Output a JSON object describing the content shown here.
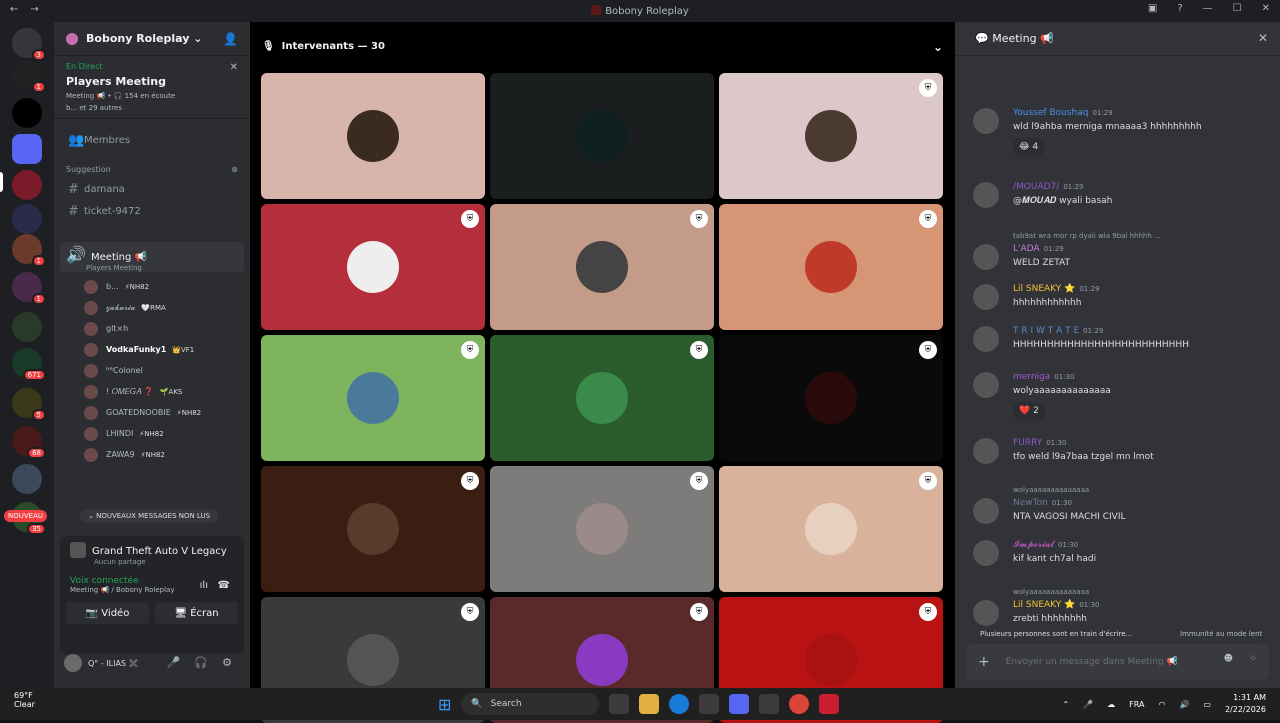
{
  "window": {
    "title": "Bobony Roleplay"
  },
  "server": {
    "name": "Bobony Roleplay"
  },
  "event": {
    "status": "En Direct",
    "name": "Players Meeting",
    "meta": "Meeting 📢 • 🎧 154 en écoute",
    "others": "b... et 29 autres"
  },
  "channels": {
    "members": "Membres",
    "category": "Suggestion",
    "list": [
      "damana",
      "ticket-9472"
    ]
  },
  "voice_channel": {
    "name": "Meeting 📢",
    "subtitle": "Players Meeting"
  },
  "voice_users": [
    {
      "name": "b...",
      "tag": "⚡NH82"
    },
    {
      "name": "𝔃𝓪𝓴𝓪𝓻𝓲𝓪",
      "tag": "🤍RMA"
    },
    {
      "name": "glt×h",
      "tag": ""
    },
    {
      "name": "VodkaFunky1",
      "tag": "👑VF1"
    },
    {
      "name": "ᴿᴿColonel",
      "tag": ""
    },
    {
      "name": "! 𝑂𝑀𝐸𝐺𝐴 ❓",
      "tag": "🌱AKS"
    },
    {
      "name": "GOATEDNOOBIE",
      "tag": "⚡NH82"
    },
    {
      "name": "LHINDI",
      "tag": "⚡NH82"
    },
    {
      "name": "ZAWA9",
      "tag": "⚡NH82"
    }
  ],
  "new_messages": "⌄ NOUVEAUX MESSAGES NON LUS",
  "nouveau": "NOUVEAU",
  "activity": {
    "game": "Grand Theft Auto V Legacy",
    "game_sub": "Aucun partage",
    "voice_status": "Voix connectée",
    "voice_detail": "Meeting 📢 / Bobony Roleplay",
    "video": "Vidéo",
    "screen": "Écran"
  },
  "user": {
    "name": "Q° - ILIAS ✖️"
  },
  "stage": {
    "header": "Intervenants — 30"
  },
  "tiles": [
    {
      "bg": "#d8b5aa",
      "av": "#3a2a20",
      "shield": false
    },
    {
      "bg": "#1a1e1e",
      "av": "#102020",
      "shield": false
    },
    {
      "bg": "#dcc8c8",
      "av": "#4a3a30",
      "shield": true
    },
    {
      "bg": "#b52e3c",
      "av": "#eee",
      "shield": true
    },
    {
      "bg": "#c49a88",
      "av": "#444",
      "shield": true
    },
    {
      "bg": "#d69575",
      "av": "#c03a2a",
      "shield": true
    },
    {
      "bg": "#7fb45f",
      "av": "#4a7a9a",
      "shield": true
    },
    {
      "bg": "#2b5c2e",
      "av": "#3a8a4a",
      "shield": true
    },
    {
      "bg": "#0a0a0a",
      "av": "#2a0a0a",
      "shield": true
    },
    {
      "bg": "#3a1e12",
      "av": "#5a3a2a",
      "shield": true
    },
    {
      "bg": "#7e7b7b",
      "av": "#9a8a8a",
      "shield": true
    },
    {
      "bg": "#d8b29a",
      "av": "#e8d0c0",
      "shield": true
    },
    {
      "bg": "#3a3a3a",
      "av": "#555",
      "shield": true
    },
    {
      "bg": "#5a2a2a",
      "av": "#8a3ac0",
      "shield": true
    },
    {
      "bg": "#b81212",
      "av": "#aa1111",
      "shield": true
    }
  ],
  "chat": {
    "title": "Meeting 📢",
    "messages": [
      {
        "name": "Youssef Boushaq",
        "color": "#4a90e2",
        "time": "01:29",
        "text": "wld l9ahba merniga mnaaaa3 hhhhhhhhh",
        "reaction": "😂 4"
      },
      {
        "name": "/MOUAD7/",
        "color": "#8a5ac8",
        "time": "01:29",
        "text": "@𝑴𝑶𝑼𝑨𝑫 wyali basah",
        "reaction": ""
      },
      {
        "name": "L'ADA",
        "color": "#c87ad8",
        "time": "01:29",
        "text": "WELD ZETAT",
        "reply": "tab9at wra mor rp dyali wla 9bal hhhhh ...",
        "reaction": ""
      },
      {
        "name": "Lil SNEAKY ⭐",
        "color": "#f0c030",
        "time": "01:29",
        "text": "hhhhhhhhhhhh",
        "reaction": ""
      },
      {
        "name": "T R I W T A T E",
        "color": "#5a8ac8",
        "time": "01:29",
        "text": "HHHHHHHHHHHHHHHHHHHHHHHHHH",
        "reaction": ""
      },
      {
        "name": "merniga",
        "color": "#a05ad0",
        "time": "01:30",
        "text": "wolyaaaaaaaaaaaaaa",
        "reaction": "❤️ 2"
      },
      {
        "name": "FURRY",
        "color": "#8a5ac8",
        "time": "01:30",
        "text": "tfo weld l9a7baa tzgel mn lmot",
        "reaction": ""
      },
      {
        "name": "NewTon",
        "color": "#6a7a9a",
        "time": "01:30",
        "text": "NTA VAGOSI MACHI CIVIL",
        "reply": "wolyaaaaaaaaaaaaaa",
        "reaction": ""
      },
      {
        "name": "𝓘𝓶𝓹𝓮𝓻𝓲𝓪𝓵",
        "color": "#c85ac8",
        "time": "01:30",
        "text": "kif kant ch7al hadi",
        "reaction": ""
      },
      {
        "name": "Lil SNEAKY ⭐",
        "color": "#f0c030",
        "time": "01:30",
        "text": "zrebti hhhhhhhh",
        "reply": "wolyaaaaaaaaaaaaaa",
        "reaction": ""
      }
    ],
    "typing": "Plusieurs personnes sont en train d'écrire...",
    "immunity": "Immunité au mode lent",
    "placeholder": "Envoyer un message dans Meeting 📢"
  },
  "taskbar": {
    "temp": "69°F",
    "weather": "Clear",
    "search": "Search",
    "lang": "FRA",
    "time": "1:31 AM",
    "date": "2/22/2026"
  }
}
